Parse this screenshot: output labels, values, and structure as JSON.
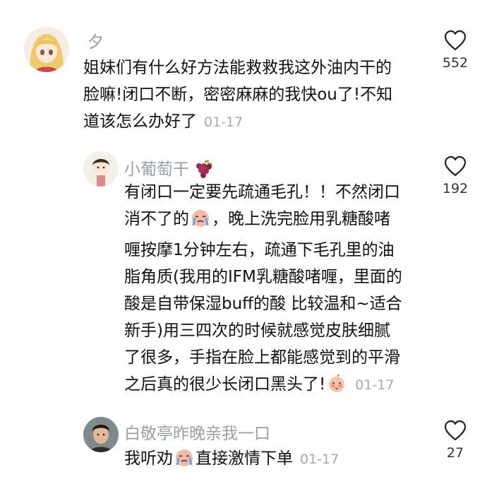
{
  "comments": [
    {
      "username": "夕",
      "lines": [
        "姐妹们有什么好方法能救救我这外油内干的",
        "脸嘛!闭口不断，密密麻麻的我快ou了!不知",
        "道该怎么办好了"
      ],
      "date": "01-17",
      "likes": "552",
      "avatar_icon": "anime-girl-avatar"
    },
    {
      "username": "小葡萄干",
      "username_emoji": "grapes-emoji",
      "lines": [
        "有闭口一定要先疏通毛孔！！不然闭口",
        "消不了的",
        "，晚上洗完脸用乳糖酸啫",
        "喱按摩1分钟左右，疏通下毛孔里的油",
        "脂角质(我用的IFM乳糖酸啫喱，里面的",
        "酸是自带保湿buff的酸 比较温和~适合",
        "新手)用三四次的时候就感觉皮肤细腻",
        "了很多，手指在脸上都能感觉到的平滑",
        "之后真的很少长闭口黑头了!"
      ],
      "date": "01-17",
      "likes": "192",
      "avatar_icon": "cartoon-girl-avatar"
    },
    {
      "username": "白敬亭昨晚亲我一口",
      "lines": [
        "我听劝",
        "直接激情下单"
      ],
      "date": "01-17",
      "likes": "27",
      "avatar_icon": "man-photo-avatar"
    }
  ],
  "colors": {
    "username": "#9aa0a6",
    "date": "#a8a8a8",
    "text": "#111111"
  }
}
